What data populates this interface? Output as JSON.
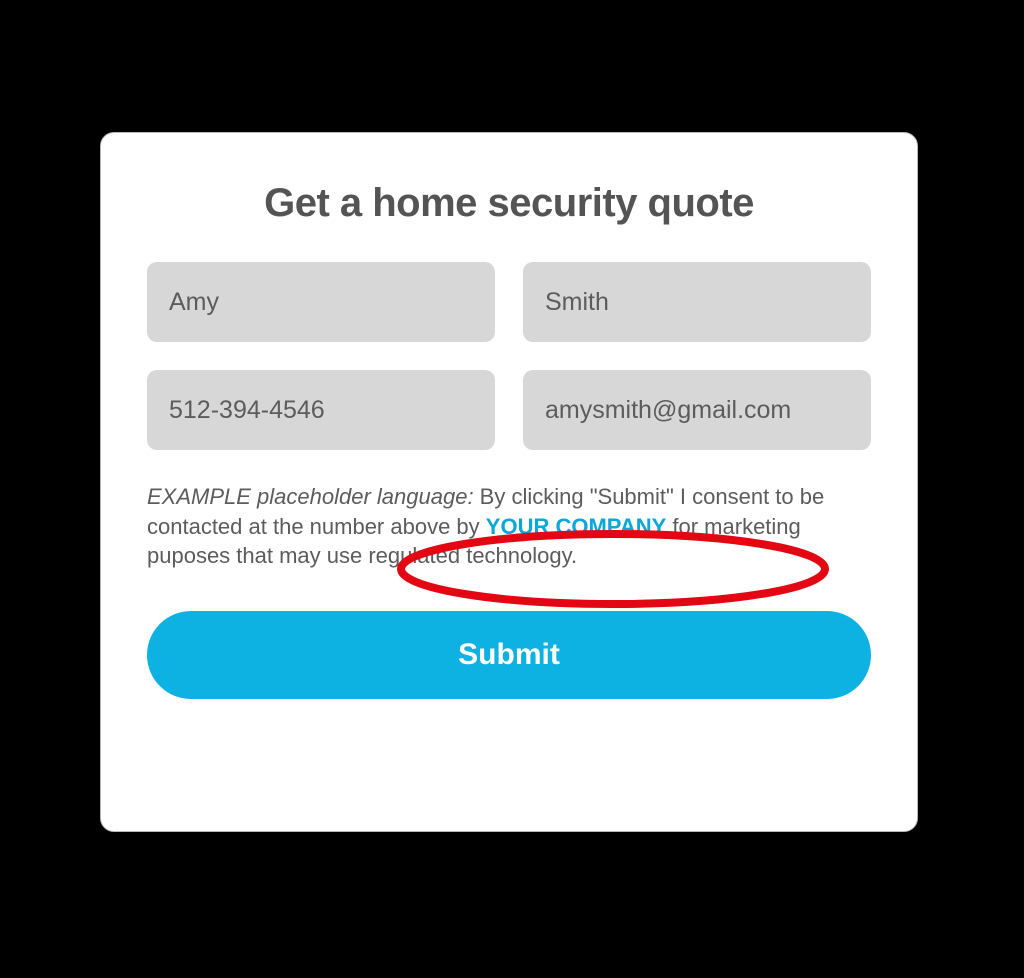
{
  "form": {
    "title": "Get a home security quote",
    "fields": {
      "first_name": "Amy",
      "last_name": "Smith",
      "phone": "512-394-4546",
      "email": "amysmith@gmail.com"
    },
    "consent": {
      "lead": "EXAMPLE placeholder language:",
      "pre": " By clicking \"Submit\" I consent to be contacted at the number above by ",
      "company": "YOUR COMPANY",
      "post": " for marketing puposes that may use regulated technology."
    },
    "submit_label": "Submit"
  },
  "colors": {
    "accent": "#0db1e2",
    "annotation": "#e30613"
  }
}
